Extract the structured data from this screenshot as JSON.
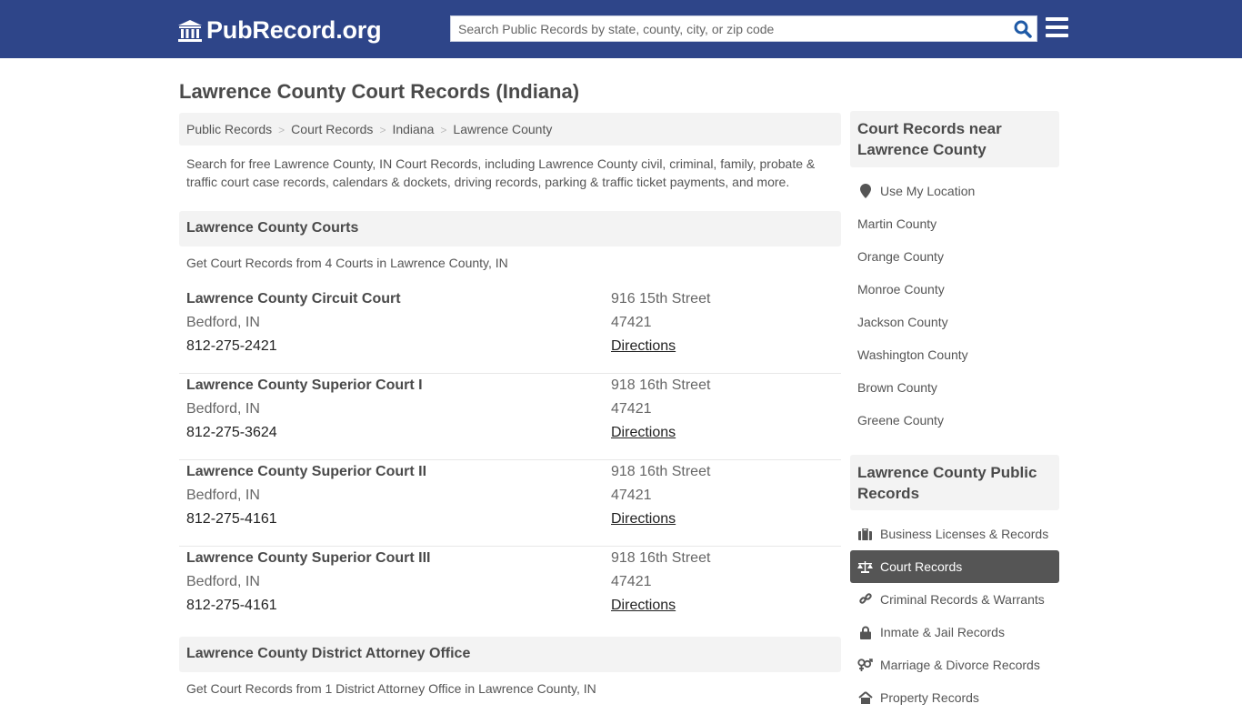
{
  "header": {
    "logo_text": "PubRecord.org",
    "search_placeholder": "Search Public Records by state, county, city, or zip code"
  },
  "page_title": "Lawrence County Court Records (Indiana)",
  "breadcrumb": [
    "Public Records",
    "Court Records",
    "Indiana",
    "Lawrence County"
  ],
  "intro": "Search for free Lawrence County, IN Court Records, including Lawrence County civil, criminal, family, probate & traffic court case records, calendars & dockets, driving records, parking & traffic ticket payments, and more.",
  "courts_section": {
    "heading": "Lawrence County Courts",
    "subtext": "Get Court Records from 4 Courts in Lawrence County, IN",
    "courts": [
      {
        "name": "Lawrence County Circuit Court",
        "city": "Bedford, IN",
        "phone": "812-275-2421",
        "address": "916 15th Street",
        "zip": "47421",
        "link": "Directions"
      },
      {
        "name": "Lawrence County Superior Court I",
        "city": "Bedford, IN",
        "phone": "812-275-3624",
        "address": "918 16th Street",
        "zip": "47421",
        "link": "Directions"
      },
      {
        "name": "Lawrence County Superior Court II",
        "city": "Bedford, IN",
        "phone": "812-275-4161",
        "address": "918 16th Street",
        "zip": "47421",
        "link": "Directions"
      },
      {
        "name": "Lawrence County Superior Court III",
        "city": "Bedford, IN",
        "phone": "812-275-4161",
        "address": "918 16th Street",
        "zip": "47421",
        "link": "Directions"
      }
    ]
  },
  "da_section": {
    "heading": "Lawrence County District Attorney Office",
    "subtext": "Get Court Records from 1 District Attorney Office in Lawrence County, IN"
  },
  "sidebar": {
    "nearby_heading": "Court Records near Lawrence County",
    "use_location": "Use My Location",
    "nearby": [
      "Martin County",
      "Orange County",
      "Monroe County",
      "Jackson County",
      "Washington County",
      "Brown County",
      "Greene County"
    ],
    "records_heading": "Lawrence County Public Records",
    "records": [
      {
        "label": "Business Licenses & Records",
        "icon": "briefcase-icon"
      },
      {
        "label": "Court Records",
        "icon": "scale-icon",
        "active": true
      },
      {
        "label": "Criminal Records & Warrants",
        "icon": "link-icon"
      },
      {
        "label": "Inmate & Jail Records",
        "icon": "lock-icon"
      },
      {
        "label": "Marriage & Divorce Records",
        "icon": "gender-icon"
      },
      {
        "label": "Property Records",
        "icon": "home-icon"
      }
    ]
  },
  "colors": {
    "header_bg": "#2e4589",
    "active_item_bg": "#555555",
    "search_icon": "#1f5aa6"
  }
}
